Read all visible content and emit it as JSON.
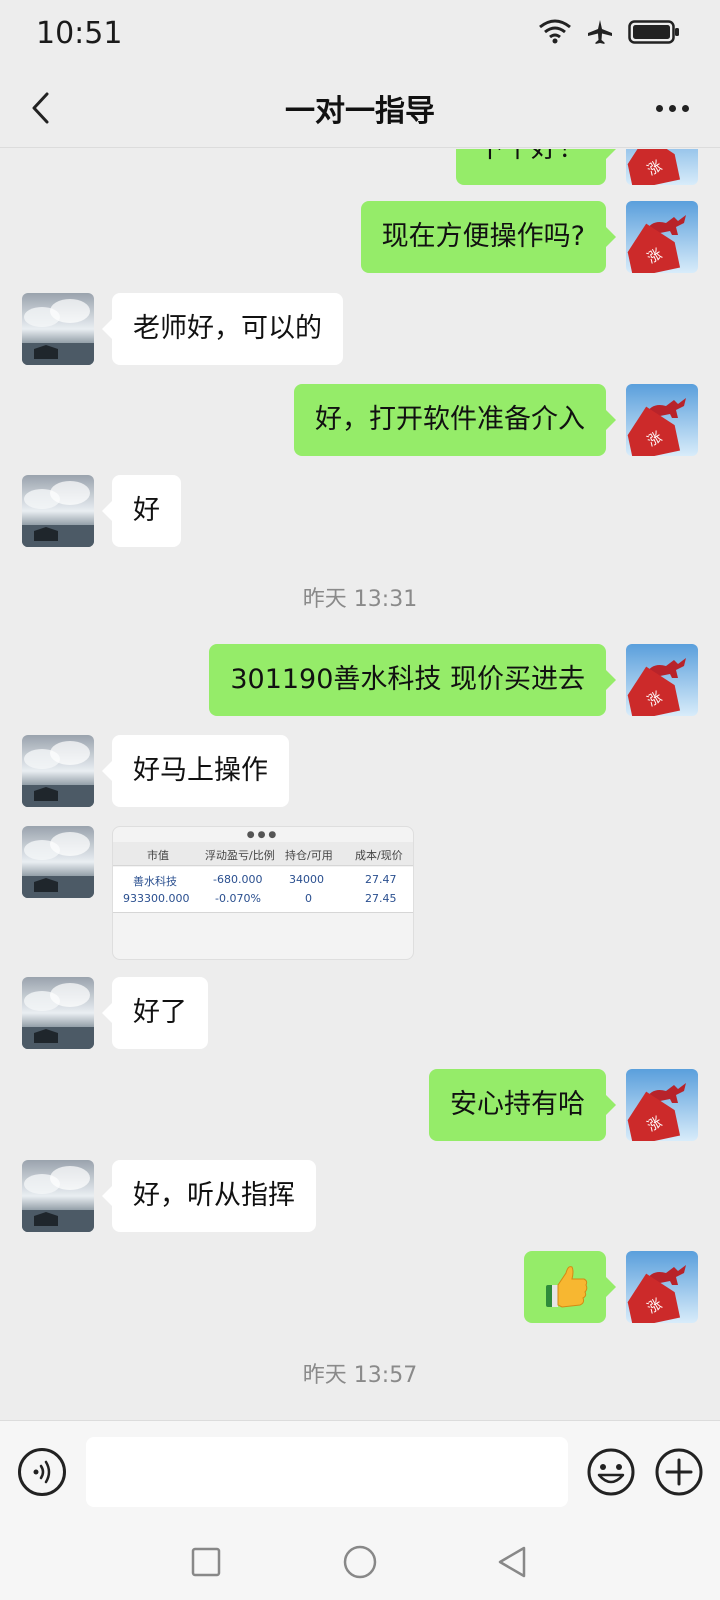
{
  "status_bar": {
    "time": "10:51"
  },
  "nav": {
    "title": "一对一指导"
  },
  "messages": [
    {
      "side": "out",
      "text": "下午好！"
    },
    {
      "side": "out",
      "text": "现在方便操作吗?"
    },
    {
      "side": "in",
      "text": "老师好，可以的"
    },
    {
      "side": "out",
      "text": "好，打开软件准备介入"
    },
    {
      "side": "in",
      "text": "好"
    },
    {
      "type": "timestamp",
      "text": "昨天 13:31"
    },
    {
      "side": "out",
      "text": "301190善水科技  现价买进去"
    },
    {
      "side": "in",
      "text": "好马上操作"
    },
    {
      "side": "in",
      "type": "image"
    },
    {
      "side": "in",
      "text": "好了"
    },
    {
      "side": "out",
      "text": "安心持有哈"
    },
    {
      "side": "in",
      "text": "好，听从指挥"
    },
    {
      "side": "out",
      "type": "emoji",
      "emoji": "thumbs-up"
    },
    {
      "type": "timestamp",
      "text": "昨天 13:57"
    }
  ],
  "holdings_image": {
    "headers": [
      "市值",
      "浮动盈亏/比例",
      "持仓/可用",
      "成本/现价"
    ],
    "row1": [
      "善水科技",
      "-680.000",
      "34000",
      "27.47"
    ],
    "row2": [
      "933300.000",
      "-0.070%",
      "0",
      "27.45"
    ]
  },
  "avatars": {
    "teacher_badge": "涨",
    "colors": {
      "out_bubble": "#95ec69",
      "in_bubble": "#ffffff",
      "bull": "#cc2a2a",
      "sky": "#7fb6e6"
    }
  },
  "icons": {
    "back": "chevron-left-icon",
    "more": "more-dots-icon",
    "voice": "voice-icon",
    "emoji": "emoji-smile-icon",
    "plus": "plus-circle-icon"
  }
}
